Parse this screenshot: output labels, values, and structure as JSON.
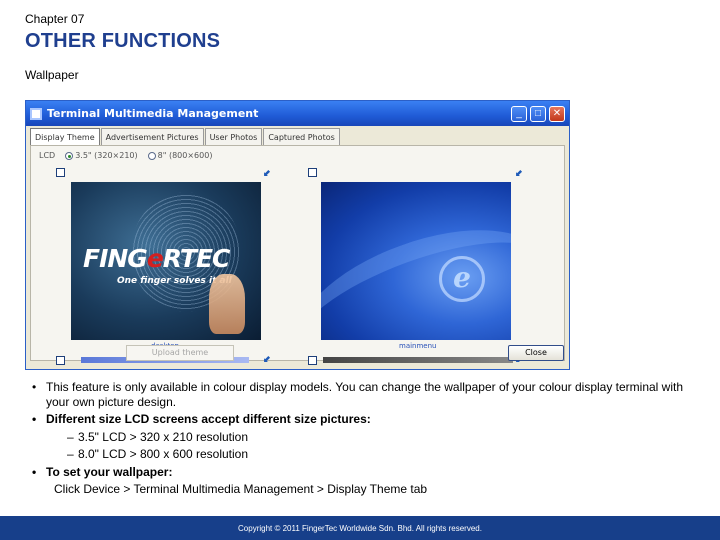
{
  "header": {
    "chapter": "Chapter 07",
    "title": "OTHER FUNCTIONS",
    "subtitle": "Wallpaper"
  },
  "window": {
    "title": "Terminal Multimedia Management",
    "buttons": {
      "minimize": "_",
      "maximize": "□",
      "close": "✕"
    },
    "tabs": [
      "Display Theme",
      "Advertisement Pictures",
      "User Photos",
      "Captured Photos"
    ],
    "active_tab": "Display Theme",
    "lcd_label": "LCD",
    "lcd_options": [
      "3.5\" (320×210)",
      "8\" (800×600)"
    ],
    "lcd_selected": "3.5\" (320×210)",
    "thumbnails": [
      {
        "caption": "desktop",
        "logo_text_1": "FING",
        "logo_text_2": "e",
        "logo_text_3": "RTEC",
        "tagline": "One finger solves it all"
      },
      {
        "caption": "mainmenu"
      }
    ],
    "upload_button": "Upload theme",
    "close_button": "Close"
  },
  "bullets": {
    "item1": "This feature is only available in colour display models. You can change the wallpaper of your colour display terminal with your own picture design.",
    "item2": "Different size LCD screens accept different size pictures:",
    "sub1": "3.5\" LCD > 320 x 210 resolution",
    "sub2": "8.0\" LCD > 800 x 600 resolution",
    "item3": "To set your wallpaper:",
    "instruction": "Click Device > Terminal Multimedia Management > Display Theme tab"
  },
  "footer": {
    "text": "Copyright © 2011 FingerTec Worldwide Sdn. Bhd. All rights reserved."
  },
  "colors": {
    "title": "#1f3f8f",
    "footer_bg": "#173f8a",
    "titlebar": "#1f5bd6"
  }
}
